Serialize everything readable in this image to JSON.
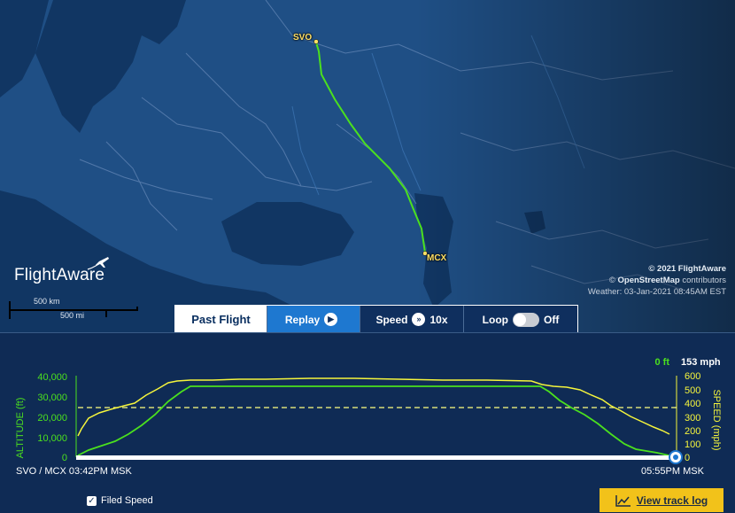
{
  "map": {
    "origin_code": "SVO",
    "destination_code": "MCX",
    "logo_text": "FlightAware",
    "scale_km": "500 km",
    "scale_mi": "500 mi",
    "credits": {
      "copyright": "© 2021 FlightAware",
      "osm_prefix": "©",
      "osm": "OpenStreetMap",
      "osm_suffix": "contributors",
      "weather": "Weather: 03-Jan-2021 08:45AM EST"
    },
    "colors": {
      "track": "#4be01e",
      "label": "#ffe066",
      "land": "#1f4f85",
      "water": "#113663"
    }
  },
  "controls": {
    "past_flight": "Past Flight",
    "replay": "Replay",
    "speed": "Speed",
    "speed_value": "10x",
    "loop": "Loop",
    "loop_state": "Off"
  },
  "chart": {
    "current_altitude": "0 ft",
    "current_speed": "153 mph",
    "left_axis_label": "ALTITUDE (ft)",
    "right_axis_label": "SPEED (mph)",
    "altitude_ticks": [
      "40,000",
      "30,000",
      "20,000",
      "10,000",
      "0"
    ],
    "speed_ticks": [
      "600",
      "500",
      "400",
      "300",
      "200",
      "100",
      "0"
    ],
    "start_label": "SVO / MCX 03:42PM MSK",
    "end_label": "05:55PM MSK",
    "filed_speed_label": "Filed Speed",
    "filed_speed_checked": true,
    "track_log_label": "View track log",
    "filed_speed_mph": 360,
    "progress": 1.0,
    "colors": {
      "altitude": "#4be01e",
      "speed": "#f5f53c",
      "filed": "#ffff80"
    }
  }
}
